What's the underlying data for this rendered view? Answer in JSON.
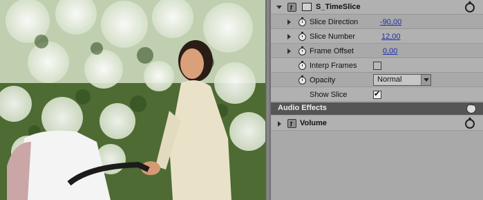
{
  "preview": {
    "description_icon": "video-preview"
  },
  "video_effects": {
    "effect_name": "S_TimeSlice",
    "params": [
      {
        "label": "Slice Direction",
        "value": "-90,00"
      },
      {
        "label": "Slice Number",
        "value": "12,00"
      },
      {
        "label": "Frame Offset",
        "value": "0,00"
      },
      {
        "label": "Interp Frames",
        "checked": false
      },
      {
        "label": "Opacity",
        "value": "Normal"
      },
      {
        "label": "Show Slice",
        "checked": true
      }
    ]
  },
  "audio_effects": {
    "header": "Audio Effects",
    "effect_name": "Volume"
  }
}
